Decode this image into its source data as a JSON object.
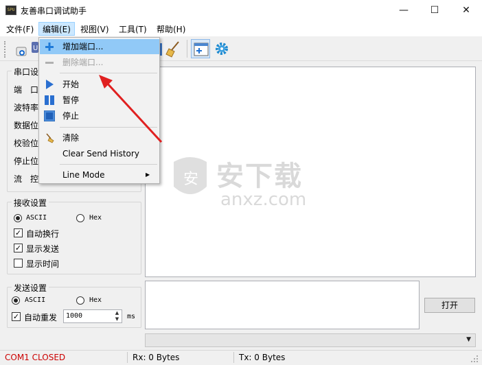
{
  "window": {
    "title": "友善串口调试助手",
    "icon_text": "SPU",
    "minimize_glyph": "—",
    "maximize_glyph": "☐",
    "close_glyph": "✕"
  },
  "menubar": {
    "file": "文件(F)",
    "edit": "编辑(E)",
    "view": "视图(V)",
    "tools": "工具(T)",
    "help": "帮助(H)"
  },
  "edit_menu": {
    "add_port": "增加端口...",
    "remove_port": "删除端口...",
    "start": "开始",
    "pause": "暂停",
    "stop": "停止",
    "clear": "清除",
    "clear_history": "Clear Send History",
    "line_mode": "Line Mode",
    "submenu_arrow": "▶"
  },
  "serial_settings": {
    "title": "串口设置",
    "title_visible": "串口设",
    "labels": [
      "端　口",
      "波特率",
      "数据位",
      "校验位",
      "停止位",
      "流　控"
    ],
    "labels_visible": [
      "端　口",
      "波特率",
      "数据位",
      "校验位",
      "停止位",
      "流　控"
    ]
  },
  "receive_settings": {
    "title": "接收设置",
    "ascii": "ASCII",
    "hex": "Hex",
    "auto_wrap": "自动换行",
    "show_send": "显示发送",
    "show_time": "显示时间",
    "mode": "ASCII",
    "auto_wrap_checked": true,
    "show_send_checked": true,
    "show_time_checked": false
  },
  "send_settings": {
    "title": "发送设置",
    "ascii": "ASCII",
    "hex": "Hex",
    "auto_resend": "自动重发",
    "interval": "1000",
    "unit": "ms",
    "mode": "ASCII",
    "auto_resend_checked": true
  },
  "open_button": "打开",
  "status": {
    "port": "COM1 CLOSED",
    "rx": "Rx: 0 Bytes",
    "tx": "Tx: 0 Bytes"
  },
  "watermark": {
    "brand": "安下载",
    "domain": "anxz.com",
    "badge": "安"
  },
  "colors": {
    "accent": "#0078d7",
    "status_closed": "#cc0000",
    "arrow": "#e02020",
    "highlight": "#91c9f7"
  }
}
